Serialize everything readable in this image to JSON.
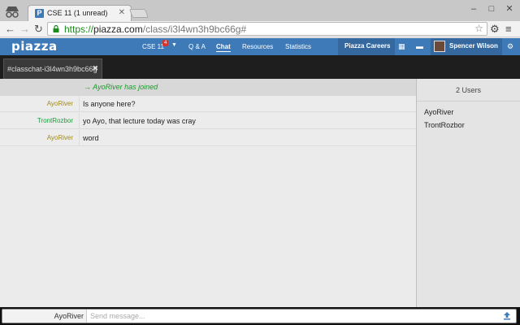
{
  "browser": {
    "tab_title": "CSE 11 (1 unread)",
    "favicon_letter": "P",
    "tab_close": "✕",
    "url_scheme": "https://",
    "url_host": "piazza.com",
    "url_path": "/class/i3l4wn3h9bc66g#"
  },
  "icons": {
    "back": "back-arrow-icon",
    "forward": "forward-arrow-icon",
    "reload": "reload-icon",
    "star": "star-icon",
    "settings": "gear-icon",
    "menu": "hamburger-menu-icon"
  },
  "piazza": {
    "logo": "piazza",
    "nav": {
      "class_label": "CSE 11",
      "class_badge": "4",
      "qa": "Q & A",
      "chat": "Chat",
      "resources": "Resources",
      "statistics": "Statistics"
    },
    "careers": "Piazza Careers",
    "user_name": "Spencer Wilson"
  },
  "chat": {
    "tab_label": "#classchat-i3l4wn3h9bc66g",
    "joined_notice": "→ AyoRiver has joined",
    "messages": [
      {
        "nick": "AyoRiver",
        "text": "Is anyone here?",
        "color": "#a08a1c"
      },
      {
        "nick": "TrontRozbor",
        "text": "yo Ayo, that lecture today was cray",
        "color": "#1a9a3a"
      },
      {
        "nick": "AyoRiver",
        "text": "word",
        "color": "#a08a1c"
      }
    ],
    "users_count": "2 Users",
    "users": [
      "AyoRiver",
      "TrontRozbor"
    ],
    "self_nick": "AyoRiver",
    "input_placeholder": "Send message..."
  }
}
